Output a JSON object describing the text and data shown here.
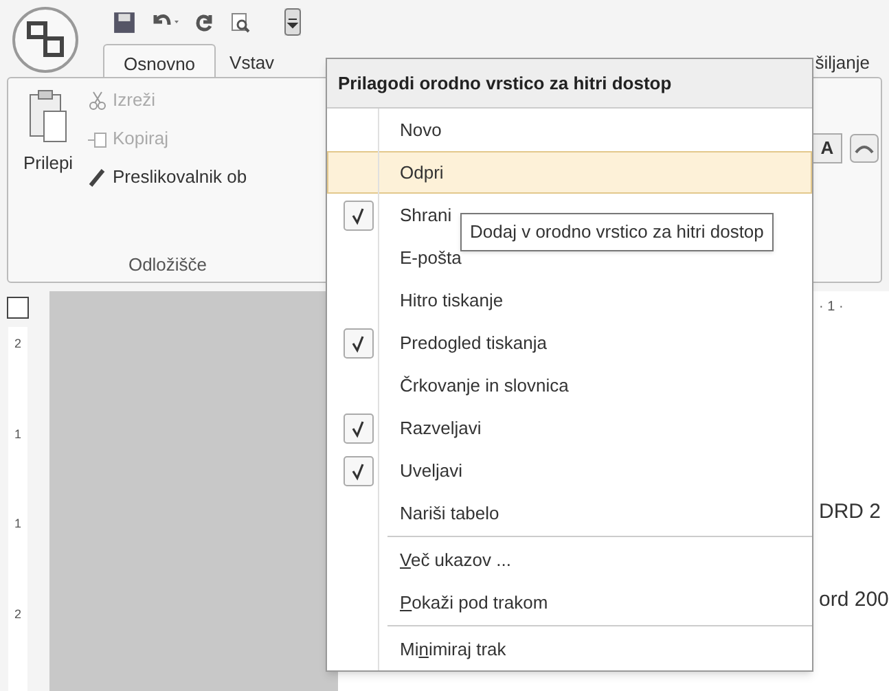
{
  "tabs": [
    {
      "label": "Osnovno",
      "selected": true
    },
    {
      "label": "Vstav",
      "selected": false
    },
    {
      "label": "šiljanje",
      "selected": false
    }
  ],
  "clipboard_group": {
    "paste": "Prilepi",
    "items": [
      {
        "label": "Izreži",
        "disabled": true
      },
      {
        "label": "Kopiraj",
        "disabled": true
      },
      {
        "label": "Preslikovalnik ob",
        "disabled": false
      }
    ],
    "title": "Odložišče"
  },
  "font_group": {
    "grow_font": "A"
  },
  "ruler": {
    "horizontal": "· 1 ·",
    "vertical": [
      "2",
      "1",
      "1",
      "2"
    ]
  },
  "document": {
    "lines": [
      "DRD  2",
      "ord 200"
    ]
  },
  "menu": {
    "title": "Prilagodi orodno vrstico za hitri dostop",
    "items": [
      {
        "kind": "command",
        "label_pre": "Novo",
        "checked": false,
        "selected": false
      },
      {
        "kind": "command",
        "label_pre": "Odpri",
        "checked": false,
        "selected": true
      },
      {
        "kind": "command",
        "label_pre": "Shrani",
        "checked": true,
        "selected": false
      },
      {
        "kind": "command",
        "label_pre": "E-pošta",
        "checked": false,
        "selected": false
      },
      {
        "kind": "command",
        "label_pre": "Hitro tiskanje",
        "checked": false,
        "selected": false
      },
      {
        "kind": "command",
        "label_pre": "Predogled tiskanja",
        "checked": true,
        "selected": false
      },
      {
        "kind": "command",
        "label_pre": "Črkovanje in slovnica",
        "checked": false,
        "selected": false
      },
      {
        "kind": "command",
        "label_pre": "Razveljavi",
        "checked": true,
        "selected": false
      },
      {
        "kind": "command",
        "label_pre": "Uveljavi",
        "checked": true,
        "selected": false
      },
      {
        "kind": "command",
        "label_pre": "Nariši tabelo",
        "checked": false,
        "selected": false
      },
      {
        "kind": "separator"
      },
      {
        "kind": "command",
        "access_key": "V",
        "label_post": "eč ukazov ...",
        "checked": false,
        "selected": false
      },
      {
        "kind": "command",
        "access_key": "P",
        "label_post": "okaži pod trakom",
        "checked": false,
        "selected": false
      },
      {
        "kind": "separator"
      },
      {
        "kind": "command",
        "label_pre": "Mi",
        "access_key": "n",
        "label_post": "imiraj trak",
        "checked": false,
        "selected": false
      }
    ]
  },
  "tooltip": "Dodaj v orodno vrstico za hitri dostop"
}
